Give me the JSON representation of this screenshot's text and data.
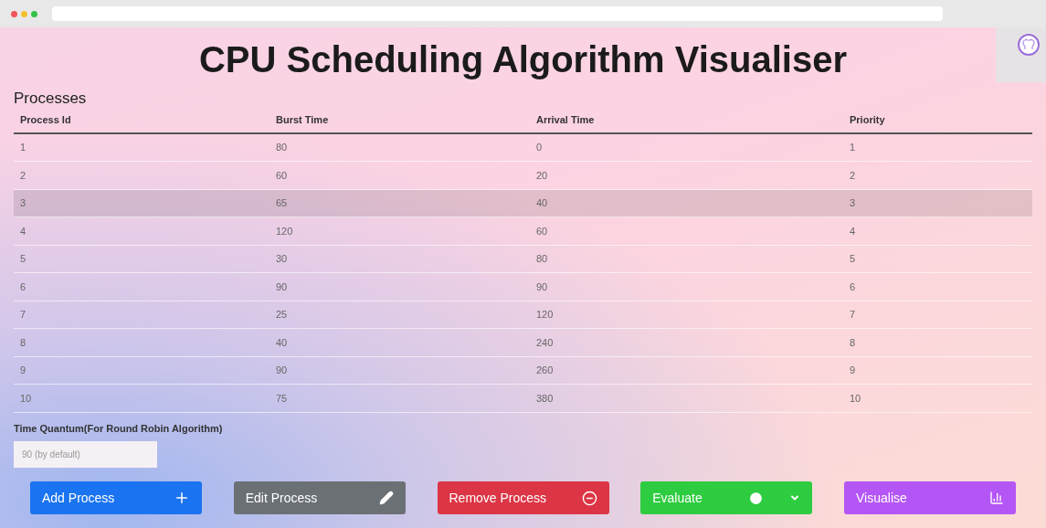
{
  "title": "CPU Scheduling Algorithm Visualiser",
  "processes": {
    "heading": "Processes",
    "columns": [
      "Process Id",
      "Burst Time",
      "Arrival Time",
      "Priority"
    ],
    "rows": [
      {
        "cells": [
          "1",
          "80",
          "0",
          "1"
        ],
        "selected": false
      },
      {
        "cells": [
          "2",
          "60",
          "20",
          "2"
        ],
        "selected": false
      },
      {
        "cells": [
          "3",
          "65",
          "40",
          "3"
        ],
        "selected": true
      },
      {
        "cells": [
          "4",
          "120",
          "60",
          "4"
        ],
        "selected": false
      },
      {
        "cells": [
          "5",
          "30",
          "80",
          "5"
        ],
        "selected": false
      },
      {
        "cells": [
          "6",
          "90",
          "90",
          "6"
        ],
        "selected": false
      },
      {
        "cells": [
          "7",
          "25",
          "120",
          "7"
        ],
        "selected": false
      },
      {
        "cells": [
          "8",
          "40",
          "240",
          "8"
        ],
        "selected": false
      },
      {
        "cells": [
          "9",
          "90",
          "260",
          "9"
        ],
        "selected": false
      },
      {
        "cells": [
          "10",
          "75",
          "380",
          "10"
        ],
        "selected": false
      }
    ]
  },
  "time_quantum": {
    "label": "Time Quantum(For Round Robin Algorithm)",
    "placeholder": "90 (by default)"
  },
  "buttons": [
    {
      "kind": "add",
      "label": "Add Process"
    },
    {
      "kind": "edit",
      "label": "Edit Process"
    },
    {
      "kind": "remove",
      "label": "Remove Process"
    },
    {
      "kind": "evaluate",
      "label": "Evaluate"
    },
    {
      "kind": "visualise",
      "label": "Visualise"
    }
  ]
}
